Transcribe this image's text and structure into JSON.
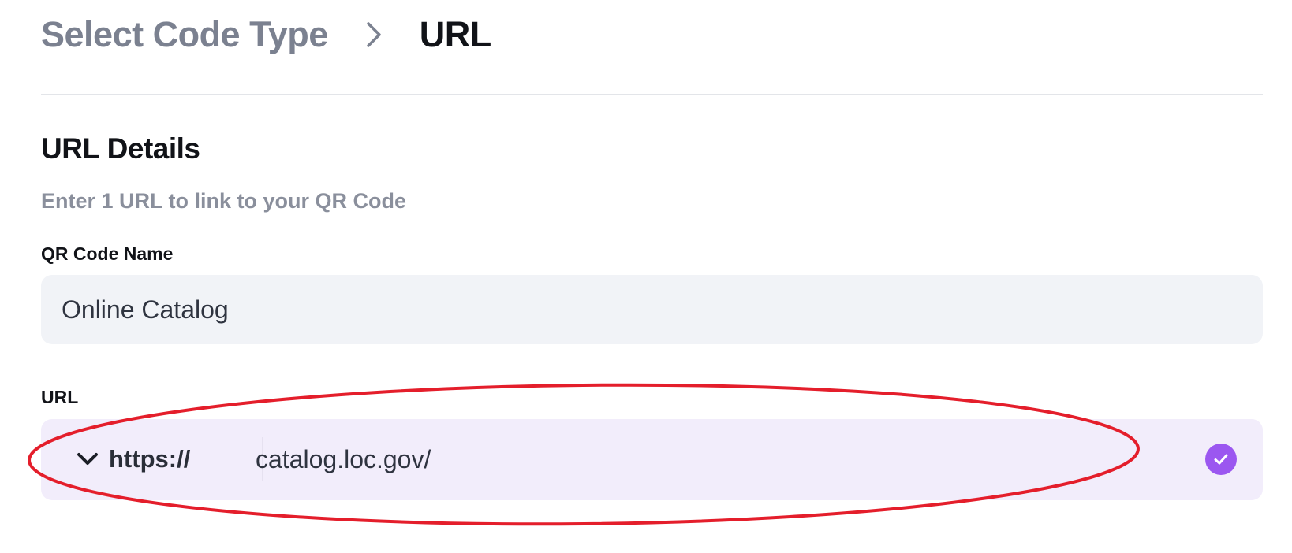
{
  "breadcrumb": {
    "parent": "Select Code Type",
    "current": "URL",
    "separator_icon": "chevron-right-icon"
  },
  "section": {
    "title": "URL Details",
    "subtitle": "Enter 1 URL to link to your QR Code"
  },
  "qr_name": {
    "label": "QR Code Name",
    "value": "Online Catalog"
  },
  "url": {
    "label": "URL",
    "protocol": "https://",
    "protocol_icon": "chevron-down-icon",
    "value": "catalog.loc.gov/",
    "status_icon": "check-circle-icon",
    "accent_color": "#9b57f0",
    "field_background": "#f2edfb"
  },
  "annotation": {
    "shape": "ellipse",
    "color": "#e41e2b"
  }
}
